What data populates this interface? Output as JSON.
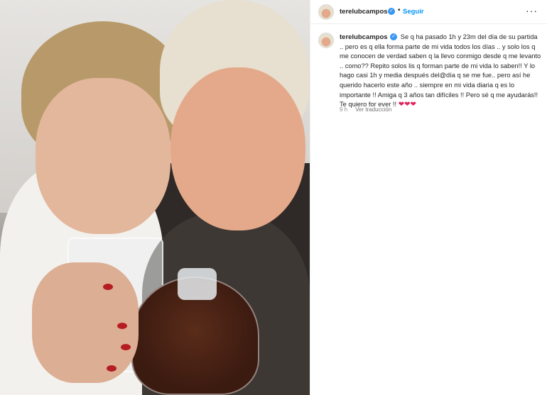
{
  "post": {
    "username": "terelubcampos",
    "verified_icon": "verified-badge-icon",
    "follow_label": "Seguir",
    "separator": "•",
    "more_label": "···"
  },
  "caption": {
    "username": "terelubcampos",
    "text": "Se q ha pasado 1h y 23m del día de su partida .. pero es q ella forma parte de mi vida todos los días .. y solo los q me conocen de verdad saben q la llevo conmigo desde q me levanto .. como?? Repito solos lis q forman parte de mi vida lo saben!! Y lo hago casi 1h y media después del@día q se me fue.. pero así he querido hacerlo este año .. siempre en mi vida diaria q es lo importante !! Amiga q 3 años tan difíciles !! Pero sé q me ayudarás!! Te quiero for ever !!",
    "hearts": "❤❤❤",
    "time": "9 h",
    "translate_label": "Ver traducción"
  },
  "colors": {
    "accent": "#0095f6",
    "verified": "#3897f0",
    "heart": "#e0245e"
  }
}
